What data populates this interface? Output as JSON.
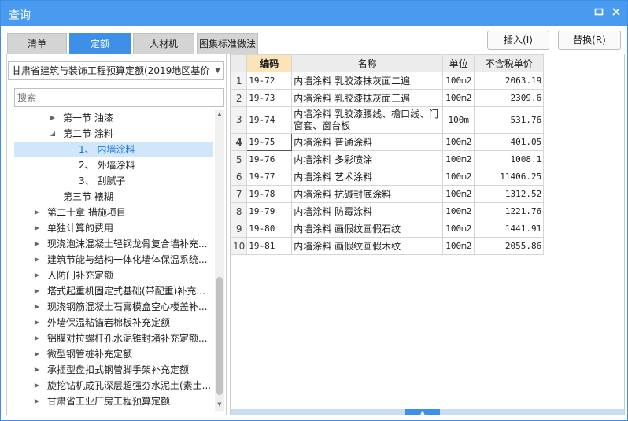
{
  "window": {
    "title": "查询"
  },
  "tabs": [
    {
      "label": "清单"
    },
    {
      "label": "定额"
    },
    {
      "label": "人材机"
    },
    {
      "label": "图集标准做法"
    }
  ],
  "buttons": {
    "insert": "插入(I)",
    "replace": "替换(R)"
  },
  "quota_select": {
    "value": "甘肃省建筑与装饰工程预算定额(2019地区基价"
  },
  "search": {
    "placeholder": "搜索"
  },
  "tree": [
    {
      "label": "第一节 油漆",
      "toggle": "▶"
    },
    {
      "label": "第二节 涂料",
      "toggle": "◢"
    },
    {
      "label": "1、 内墙涂料",
      "toggle": ""
    },
    {
      "label": "2、 外墙涂料",
      "toggle": ""
    },
    {
      "label": "3、 刮腻子",
      "toggle": ""
    },
    {
      "label": "第三节 裱糊",
      "toggle": ""
    },
    {
      "label": "第二十章 措施项目",
      "toggle": "▶"
    },
    {
      "label": "单独计算的费用",
      "toggle": "▶"
    },
    {
      "label": "现浇泡沫混凝土轻钢龙骨复合墙补充...",
      "toggle": "▶"
    },
    {
      "label": "建筑节能与结构一体化墙体保温系统...",
      "toggle": "▶"
    },
    {
      "label": "人防门补充定额",
      "toggle": "▶"
    },
    {
      "label": "塔式起重机固定式基础(带配重)补充...",
      "toggle": "▶"
    },
    {
      "label": "现浇钢筋混凝土石膏模盒空心楼盖补...",
      "toggle": "▶"
    },
    {
      "label": "外墙保温粘锚岩棉板补充定额",
      "toggle": "▶"
    },
    {
      "label": "铝膜对拉螺杆孔水泥锥封堵补充定额...",
      "toggle": "▶"
    },
    {
      "label": "微型钢管桩补充定额",
      "toggle": "▶"
    },
    {
      "label": "承插型盘扣式钢管脚手架补充定额",
      "toggle": "▶"
    },
    {
      "label": "旋挖钻机成孔深层超强夯水泥土(素土...",
      "toggle": "▶"
    },
    {
      "label": "甘肃省工业厂房工程预算定额",
      "toggle": "▶"
    }
  ],
  "table": {
    "headers": {
      "code": "编码",
      "name": "名称",
      "unit": "单位",
      "price": "不含税单价"
    },
    "rows": [
      {
        "n": "1",
        "code": "19-72",
        "name": "内墙涂料 乳胶漆抹灰面二遍",
        "unit": "100m2",
        "price": "2063.19"
      },
      {
        "n": "2",
        "code": "19-73",
        "name": "内墙涂料 乳胶漆抹灰面三遍",
        "unit": "100m2",
        "price": "2309.6"
      },
      {
        "n": "3",
        "code": "19-74",
        "name": "内墙涂料 乳胶漆腰线、檐口线、门窗套、窗台板",
        "unit": "100m",
        "price": "531.76"
      },
      {
        "n": "4",
        "code": "19-75",
        "name": "内墙涂料 普通涂料",
        "unit": "100m2",
        "price": "401.05"
      },
      {
        "n": "5",
        "code": "19-76",
        "name": "内墙涂料 多彩喷涂",
        "unit": "100m2",
        "price": "1008.1"
      },
      {
        "n": "6",
        "code": "19-77",
        "name": "内墙涂料 艺术涂料",
        "unit": "100m2",
        "price": "11406.25"
      },
      {
        "n": "7",
        "code": "19-78",
        "name": "内墙涂料 抗碱封底涂料",
        "unit": "100m2",
        "price": "1312.52"
      },
      {
        "n": "8",
        "code": "19-79",
        "name": "内墙涂料 防霉涂料",
        "unit": "100m2",
        "price": "1221.76"
      },
      {
        "n": "9",
        "code": "19-80",
        "name": "内墙涂料 画假纹画假石纹",
        "unit": "100m2",
        "price": "1441.91"
      },
      {
        "n": "10",
        "code": "19-81",
        "name": "内墙涂料 画假纹画假木纹",
        "unit": "100m2",
        "price": "2055.86"
      }
    ]
  },
  "colors": {
    "titlebar": "#4a9bf0",
    "active_tab": "#3d8fe8",
    "selected_row": "#cfe6fb",
    "header_highlight": "#fde3b8"
  }
}
